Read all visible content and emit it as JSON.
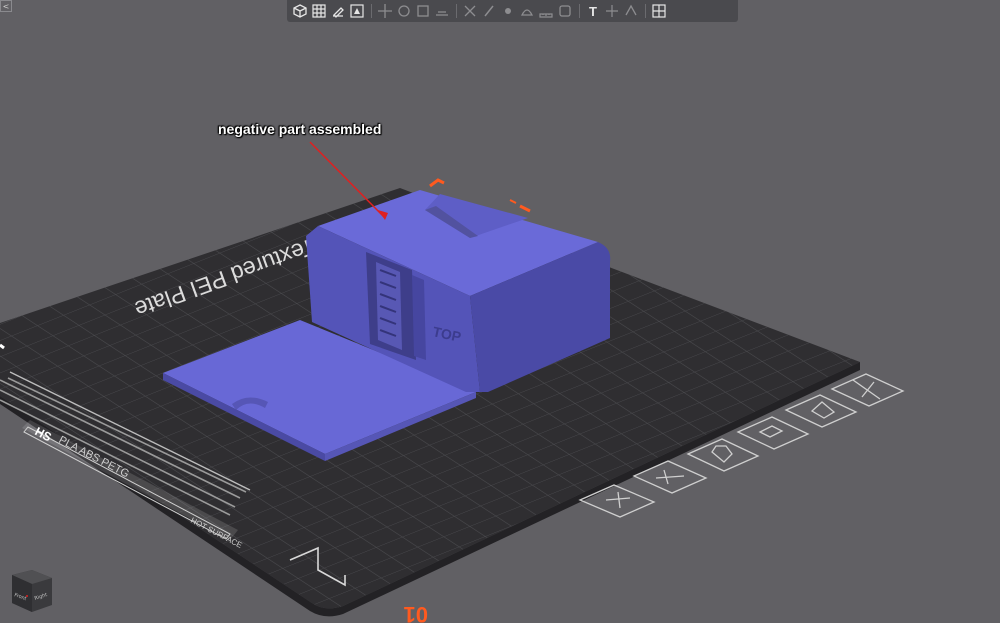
{
  "app": {
    "toolbar_text_tool_glyph": "T"
  },
  "annotation": {
    "callout_text": "negative part assembled"
  },
  "plate": {
    "title": "Textured PEI Plate",
    "material_text": "PLA ABS PETG",
    "logo_text": "HS",
    "hot_surface_text": "HOT SURFACE",
    "plate_number": "01"
  },
  "model": {
    "embossed_text": "TOP"
  },
  "view_cube": {
    "front_label": "Front",
    "right_label": "Right"
  },
  "colors": {
    "background": "#616064",
    "plate": "#2f2e31",
    "grid": "#3c3b3f",
    "model_top": "#6a6ad8",
    "model_side": "#5454b8",
    "model_front": "#48489e",
    "accent": "#ff5a1f",
    "callout_arrow": "#e02020"
  }
}
